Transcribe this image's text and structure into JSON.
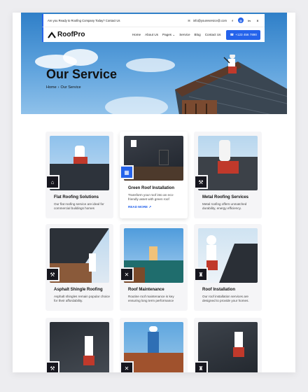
{
  "topbar": {
    "tagline": "Are you Ready to Roofing Company Today? Contact Us",
    "email": "info@youreservice@.com",
    "socials": [
      "f",
      "◎",
      "in",
      "X"
    ]
  },
  "navbar": {
    "brand": "RoofPro",
    "links": [
      "Home",
      "About Us",
      "Pages",
      "Service",
      "Blog",
      "Contact Us"
    ],
    "phone": "+123 456 7890"
  },
  "hero": {
    "title": "Our Service",
    "breadcrumb_home": "Home",
    "breadcrumb_sep": "›",
    "breadcrumb_current": "Our Service"
  },
  "cards": [
    {
      "title": "Flat Roofing Solutions",
      "desc": "Our flat roofing service are ideal for commercial buildings homes"
    },
    {
      "title": "Green Roof Installation",
      "desc": "Transform your roof into an eco-friendly asset with green roof",
      "more": "READ MORE ↗"
    },
    {
      "title": "Metal Roofing Services",
      "desc": "Metal roofing offers unmatched durability, energy efficiency."
    },
    {
      "title": "Asphalt Shingle Roofing",
      "desc": "Asphalt shingles remain popular choice for their affordability."
    },
    {
      "title": "Roof Maintenance",
      "desc": "Routine roof maintenance is key ensuring long term performance"
    },
    {
      "title": "Roof Installation",
      "desc": "Our roof installation services are designed to provide your homes."
    },
    {
      "title": "",
      "desc": ""
    },
    {
      "title": "",
      "desc": ""
    },
    {
      "title": "",
      "desc": ""
    }
  ],
  "colors": {
    "accent": "#2563eb",
    "dark": "#16161e"
  }
}
